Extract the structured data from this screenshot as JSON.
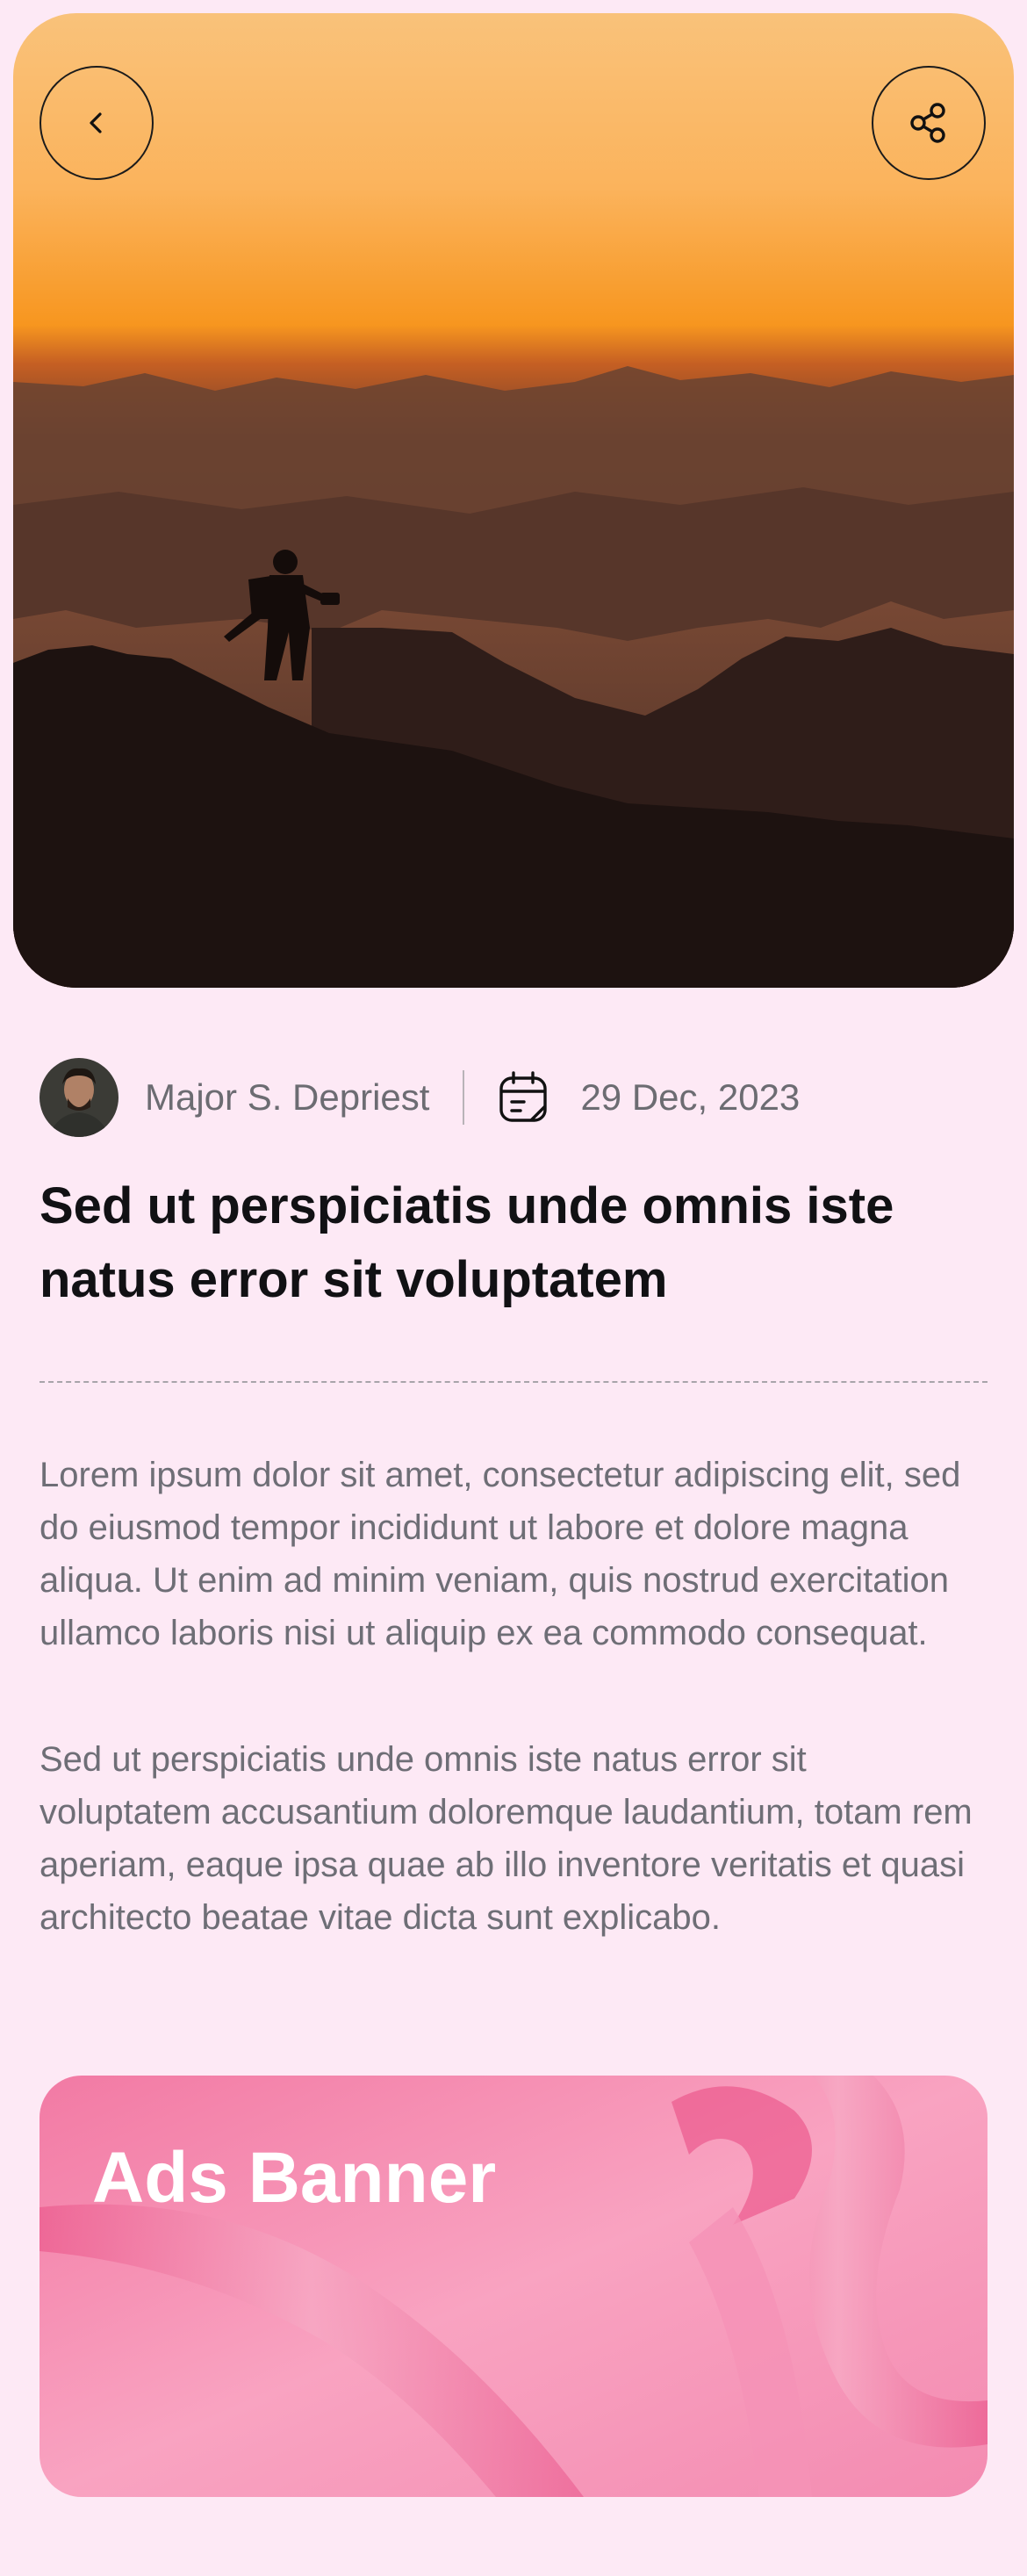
{
  "nav": {
    "back_icon": "chevron-left-icon",
    "share_icon": "share-icon"
  },
  "hero": {
    "image": "silhouette-hiker-mountains-sunset"
  },
  "meta": {
    "author": "Major S. Depriest",
    "date_icon": "calendar-icon",
    "date": "29 Dec, 2023"
  },
  "article": {
    "title": "Sed ut perspiciatis unde omnis iste natus error sit voluptatem",
    "paragraphs": [
      "Lorem ipsum dolor sit amet, consectetur adipiscing elit, sed do eiusmod tempor incididunt ut labore et dolore magna aliqua. Ut enim ad minim veniam, quis nostrud exercitation ullamco laboris nisi ut aliquip ex ea commodo consequat.",
      "Sed ut perspiciatis unde omnis iste natus error sit voluptatem accusantium doloremque laudantium, totam rem aperiam, eaque ipsa quae ab illo inventore veritatis et quasi architecto beatae vitae dicta sunt explicabo."
    ]
  },
  "ad": {
    "label": "Ads Banner"
  },
  "colors": {
    "background": "#fde9f5",
    "title_text": "#111114",
    "body_text": "#6e6e76",
    "ad_pink": "#f47aa6"
  }
}
